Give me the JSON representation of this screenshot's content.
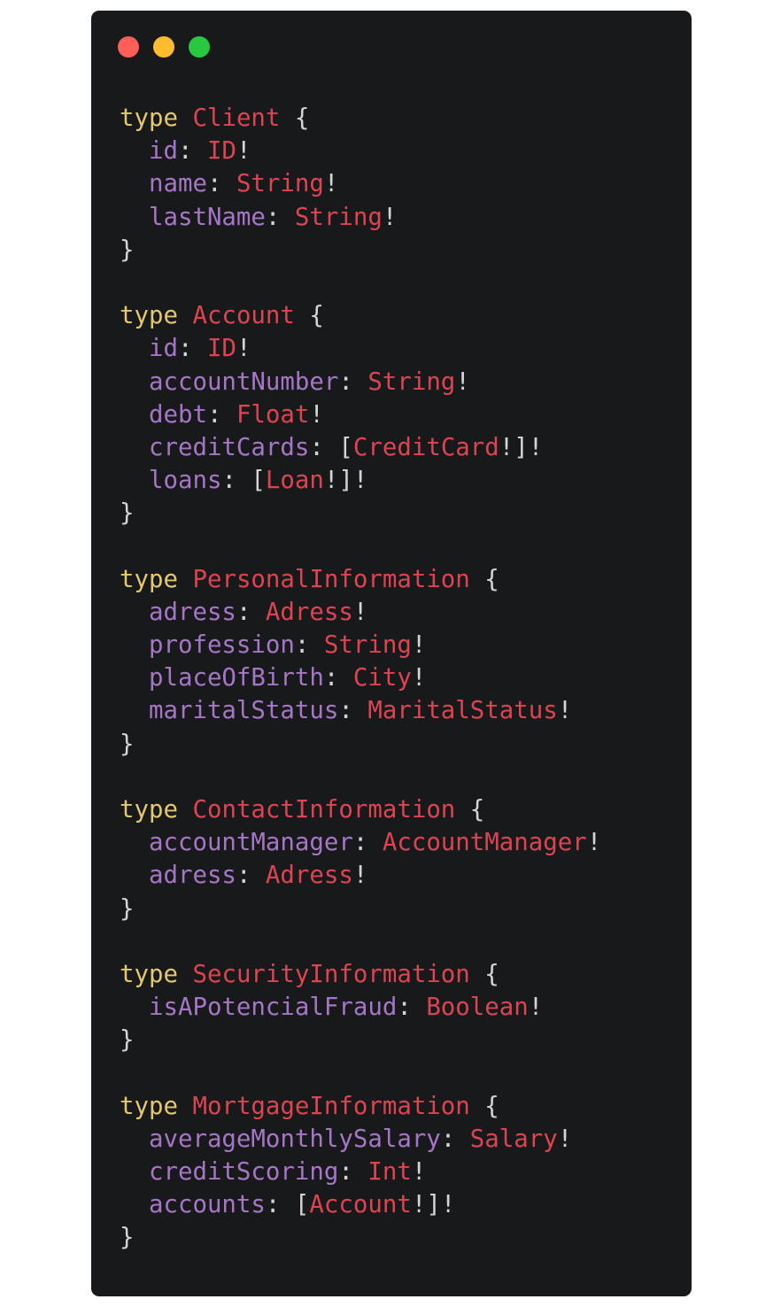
{
  "window": {
    "controls": [
      {
        "name": "close",
        "color": "#ff5f57"
      },
      {
        "name": "minimize",
        "color": "#febc2e"
      },
      {
        "name": "maximize",
        "color": "#28c840"
      }
    ]
  },
  "colors": {
    "background": "#18191b",
    "keyword": "#e3c86e",
    "type_name": "#dd4451",
    "field": "#a676c6",
    "punctuation": "#d4d4d4"
  },
  "code": {
    "language": "graphql",
    "types": [
      {
        "keyword": "type",
        "name": "Client",
        "fields": [
          {
            "name": "id",
            "type": "ID",
            "list": false
          },
          {
            "name": "name",
            "type": "String",
            "list": false
          },
          {
            "name": "lastName",
            "type": "String",
            "list": false
          }
        ]
      },
      {
        "keyword": "type",
        "name": "Account",
        "fields": [
          {
            "name": "id",
            "type": "ID",
            "list": false
          },
          {
            "name": "accountNumber",
            "type": "String",
            "list": false
          },
          {
            "name": "debt",
            "type": "Float",
            "list": false
          },
          {
            "name": "creditCards",
            "type": "CreditCard",
            "list": true
          },
          {
            "name": "loans",
            "type": "Loan",
            "list": true
          }
        ]
      },
      {
        "keyword": "type",
        "name": "PersonalInformation",
        "fields": [
          {
            "name": "adress",
            "type": "Adress",
            "list": false
          },
          {
            "name": "profession",
            "type": "String",
            "list": false
          },
          {
            "name": "placeOfBirth",
            "type": "City",
            "list": false
          },
          {
            "name": "maritalStatus",
            "type": "MaritalStatus",
            "list": false
          }
        ]
      },
      {
        "keyword": "type",
        "name": "ContactInformation",
        "fields": [
          {
            "name": "accountManager",
            "type": "AccountManager",
            "list": false
          },
          {
            "name": "adress",
            "type": "Adress",
            "list": false
          }
        ]
      },
      {
        "keyword": "type",
        "name": "SecurityInformation",
        "fields": [
          {
            "name": "isAPotencialFraud",
            "type": "Boolean",
            "list": false
          }
        ]
      },
      {
        "keyword": "type",
        "name": "MortgageInformation",
        "fields": [
          {
            "name": "averageMonthlySalary",
            "type": "Salary",
            "list": false
          },
          {
            "name": "creditScoring",
            "type": "Int",
            "list": false
          },
          {
            "name": "accounts",
            "type": "Account",
            "list": true
          }
        ]
      }
    ]
  }
}
